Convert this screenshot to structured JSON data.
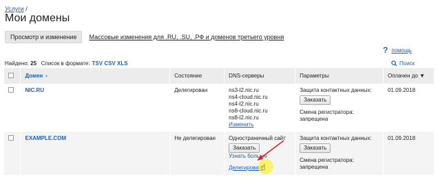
{
  "breadcrumb": {
    "link": "Услуги",
    "sep": " /"
  },
  "page_title": "Мои домены",
  "tabs": {
    "active": "Просмотр и изменение",
    "other": "Массовые изменения для .RU, .SU, .РФ и доменов третьего уровня"
  },
  "help": {
    "icon": "?",
    "label": "помощь"
  },
  "found": {
    "label": "Найдено:",
    "count": "25",
    "list_label": "Список в формате:",
    "formats": "TSV CSV XLS"
  },
  "search": {
    "icon": "search-icon",
    "label": "Поиск"
  },
  "table": {
    "headers": {
      "domain": "Домен",
      "domain_sort": "▼",
      "state": "Состояние",
      "dns": "DNS-серверы",
      "params": "Параметры",
      "paid_until": "Оплачен до ▼"
    },
    "rows": [
      {
        "domain": "NIC.RU",
        "state": "Делегирован",
        "dns": [
          "ns3-l2.nic.ru",
          "ns4-cloud.nic.ru",
          "ns4-l2.nic.ru",
          "ns8-cloud.nic.ru",
          "ns8-l2.nic.ru"
        ],
        "dns_link": "Изменить",
        "privacy": "Защита контактных данных:",
        "order": "Заказать",
        "registrar_change": "Смена регистратора:",
        "registrar_state": "запрещена",
        "paid_until": "01.09.2018"
      },
      {
        "domain": "EXAMPLE.COM",
        "state": "Не делегирован",
        "dns_text": "Одностраничный сайт",
        "dns_order": "Заказать",
        "dns_more": "Узнать больше",
        "dns_delegate": "Делегировать",
        "privacy": "Защита контактных данных:",
        "order": "Заказать",
        "registrar_change": "Смена регистратора:",
        "registrar_state": "запрещена",
        "paid_until": "01.09.2018"
      }
    ]
  },
  "colors": {
    "link": "#1a5fb4",
    "header_bg": "#ececec",
    "highlight": "#fff03c",
    "arrow": "#e02020"
  }
}
